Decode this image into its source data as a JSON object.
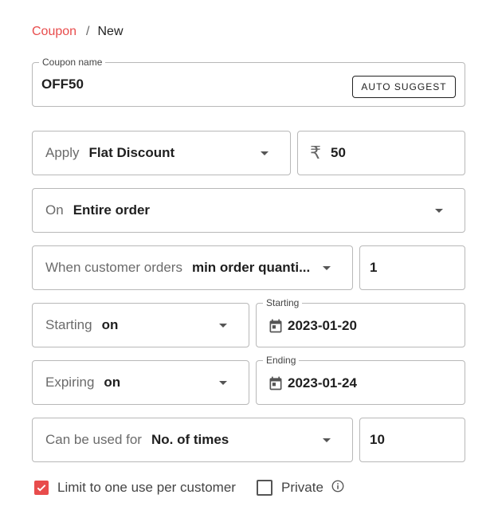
{
  "breadcrumb": {
    "parent": "Coupon",
    "separator": "/",
    "current": "New"
  },
  "coupon_name": {
    "legend": "Coupon name",
    "value": "OFF50",
    "auto_suggest": "AUTO SUGGEST"
  },
  "apply": {
    "prefix": "Apply",
    "value": "Flat Discount"
  },
  "amount": {
    "currency": "₹",
    "value": "50"
  },
  "on": {
    "prefix": "On",
    "value": "Entire order"
  },
  "when": {
    "prefix": "When customer orders",
    "value": "min order quanti...",
    "quantity": "1"
  },
  "starting": {
    "prefix": "Starting",
    "value": "on",
    "date_legend": "Starting",
    "date": "2023-01-20"
  },
  "expiring": {
    "prefix": "Expiring",
    "value": "on",
    "date_legend": "Ending",
    "date": "2023-01-24"
  },
  "usage": {
    "prefix": "Can be used for",
    "value": "No. of times",
    "count": "10"
  },
  "options": {
    "limit_label": "Limit to one use per customer",
    "limit_checked": true,
    "private_label": "Private",
    "private_checked": false
  },
  "colors": {
    "accent": "#e84c4c",
    "border": "#b8b8b8"
  }
}
